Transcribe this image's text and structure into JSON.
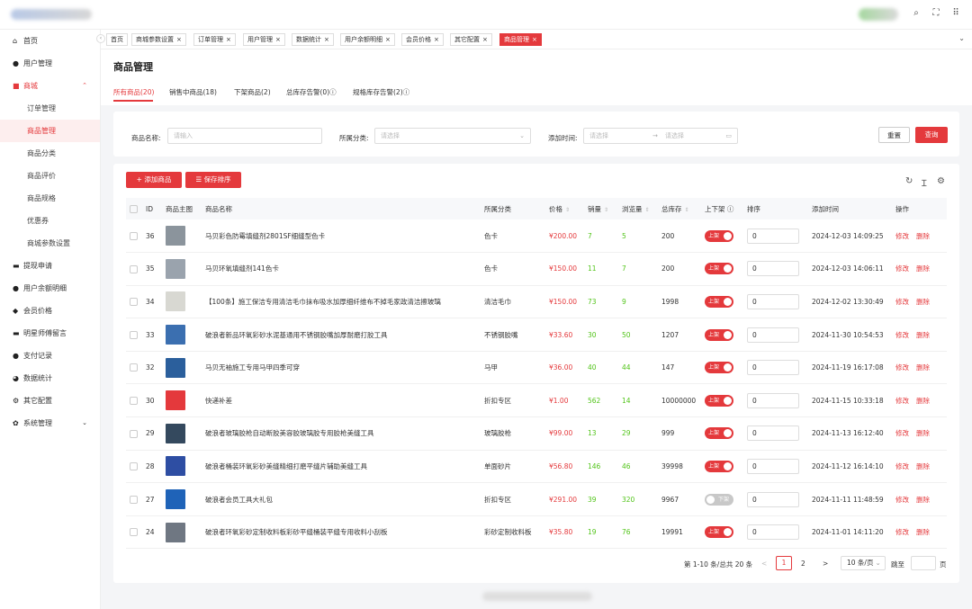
{
  "top": {
    "icons": [
      "search-icon",
      "fullscreen-icon",
      "apps-icon"
    ]
  },
  "sidebar": {
    "items": [
      {
        "label": "首页",
        "icon": "home-icon"
      },
      {
        "label": "用户管理",
        "icon": "user-icon"
      },
      {
        "label": "商城",
        "icon": "mall-icon",
        "expanded": true
      },
      {
        "label": "提现申请",
        "icon": "withdraw-icon"
      },
      {
        "label": "用户余额明细",
        "icon": "balance-icon"
      },
      {
        "label": "会员价格",
        "icon": "member-icon"
      },
      {
        "label": "明星师傅留言",
        "icon": "message-icon"
      },
      {
        "label": "支付记录",
        "icon": "pay-icon"
      },
      {
        "label": "数据统计",
        "icon": "stats-icon"
      },
      {
        "label": "其它配置",
        "icon": "config-icon"
      },
      {
        "label": "系统管理",
        "icon": "system-icon"
      }
    ],
    "mall_sub": [
      "订单管理",
      "商品管理",
      "商品分类",
      "商品评价",
      "商品规格",
      "优惠券",
      "商城参数设置"
    ]
  },
  "tabs": [
    "首页",
    "商城参数设置",
    "订单管理",
    "用户管理",
    "数据统计",
    "用户余额明细",
    "会员价格",
    "其它配置",
    "商品管理"
  ],
  "page": {
    "title": "商品管理",
    "subtabs": [
      "所有商品(20)",
      "销售中商品(18)",
      "下架商品(2)",
      "总库存告警(0)",
      "规格库存告警(2)"
    ]
  },
  "filter": {
    "name_label": "商品名称:",
    "name_placeholder": "请输入",
    "category_label": "所属分类:",
    "category_placeholder": "请选择",
    "time_label": "添加时间:",
    "time_start": "请选择",
    "time_arrow": "→",
    "time_end": "请选择",
    "reset": "重置",
    "search": "查询"
  },
  "toolbar": {
    "add": "添加商品",
    "save_sort": "保存排序"
  },
  "table": {
    "headers": [
      "ID",
      "商品主图",
      "商品名称",
      "所属分类",
      "价格",
      "销量",
      "浏览量",
      "总库存",
      "上下架",
      "排序",
      "添加时间",
      "操作"
    ],
    "edit": "修改",
    "delete": "删除",
    "on_label": "上架",
    "off_label": "下架",
    "rows": [
      {
        "id": "36",
        "name": "马贝彩色防霉填缝剂2801SF细缝型色卡",
        "cat": "色卡",
        "price": "¥200.00",
        "sales": "7",
        "views": "5",
        "stock": "200",
        "on": true,
        "sort": "0",
        "time": "2024-12-03 14:09:25",
        "thumb": "#8b949c"
      },
      {
        "id": "35",
        "name": "马贝环氧填缝剂141色卡",
        "cat": "色卡",
        "price": "¥150.00",
        "sales": "11",
        "views": "7",
        "stock": "200",
        "on": true,
        "sort": "0",
        "time": "2024-12-03 14:06:11",
        "thumb": "#9aa3ad"
      },
      {
        "id": "34",
        "name": "【100条】施工保洁专用清洁毛巾抹布吸水加厚细纤维布不掉毛家政清洁擦玻璃",
        "cat": "清洁毛巾",
        "price": "¥150.00",
        "sales": "73",
        "views": "9",
        "stock": "1998",
        "on": true,
        "sort": "0",
        "time": "2024-12-02 13:30:49",
        "thumb": "#d8d8d2"
      },
      {
        "id": "33",
        "name": "破浪者新品环氧彩砂水泥基通用不锈钢胶嘴加厚耐磨打胶工具",
        "cat": "不锈钢胶嘴",
        "price": "¥33.60",
        "sales": "30",
        "views": "50",
        "stock": "1207",
        "on": true,
        "sort": "0",
        "time": "2024-11-30 10:54:53",
        "thumb": "#3b6fb0"
      },
      {
        "id": "32",
        "name": "马贝无袖施工专用马甲四季可穿",
        "cat": "马甲",
        "price": "¥36.00",
        "sales": "40",
        "views": "44",
        "stock": "147",
        "on": true,
        "sort": "0",
        "time": "2024-11-19 16:17:08",
        "thumb": "#2b5f9c"
      },
      {
        "id": "30",
        "name": "快递补差",
        "cat": "折扣专区",
        "price": "¥1.00",
        "sales": "562",
        "views": "14",
        "stock": "10000000",
        "on": true,
        "sort": "0",
        "time": "2024-11-15 10:33:18",
        "thumb": "#e4393c"
      },
      {
        "id": "29",
        "name": "破浪者玻璃胶枪自动断胶美容胶玻璃胶专用胶枪美缝工具",
        "cat": "玻璃胶枪",
        "price": "¥99.00",
        "sales": "13",
        "views": "29",
        "stock": "999",
        "on": true,
        "sort": "0",
        "time": "2024-11-13 16:12:40",
        "thumb": "#34495e"
      },
      {
        "id": "28",
        "name": "破浪者桶装环氧彩砂美缝精细打磨平缝片辅助美缝工具",
        "cat": "单面砂片",
        "price": "¥56.80",
        "sales": "146",
        "views": "46",
        "stock": "39998",
        "on": true,
        "sort": "0",
        "time": "2024-11-12 16:14:10",
        "thumb": "#2e4ea3"
      },
      {
        "id": "27",
        "name": "破浪者会员工具大礼包",
        "cat": "折扣专区",
        "price": "¥291.00",
        "sales": "39",
        "views": "320",
        "stock": "9967",
        "on": false,
        "sort": "0",
        "time": "2024-11-11 11:48:59",
        "thumb": "#1f63b8"
      },
      {
        "id": "24",
        "name": "破浪者环氧彩砂定制收料板彩砂平缝桶装平缝专用收料小刮板",
        "cat": "彩砂定制收料板",
        "price": "¥35.80",
        "sales": "19",
        "views": "76",
        "stock": "19991",
        "on": true,
        "sort": "0",
        "time": "2024-11-01 14:11:20",
        "thumb": "#6f7782"
      }
    ]
  },
  "pagination": {
    "summary": "第 1-10 条/总共 20 条",
    "prev": "<",
    "pages": [
      "1",
      "2"
    ],
    "next": ">",
    "size": "10 条/页",
    "goto": "跳至",
    "page_unit": "页"
  }
}
